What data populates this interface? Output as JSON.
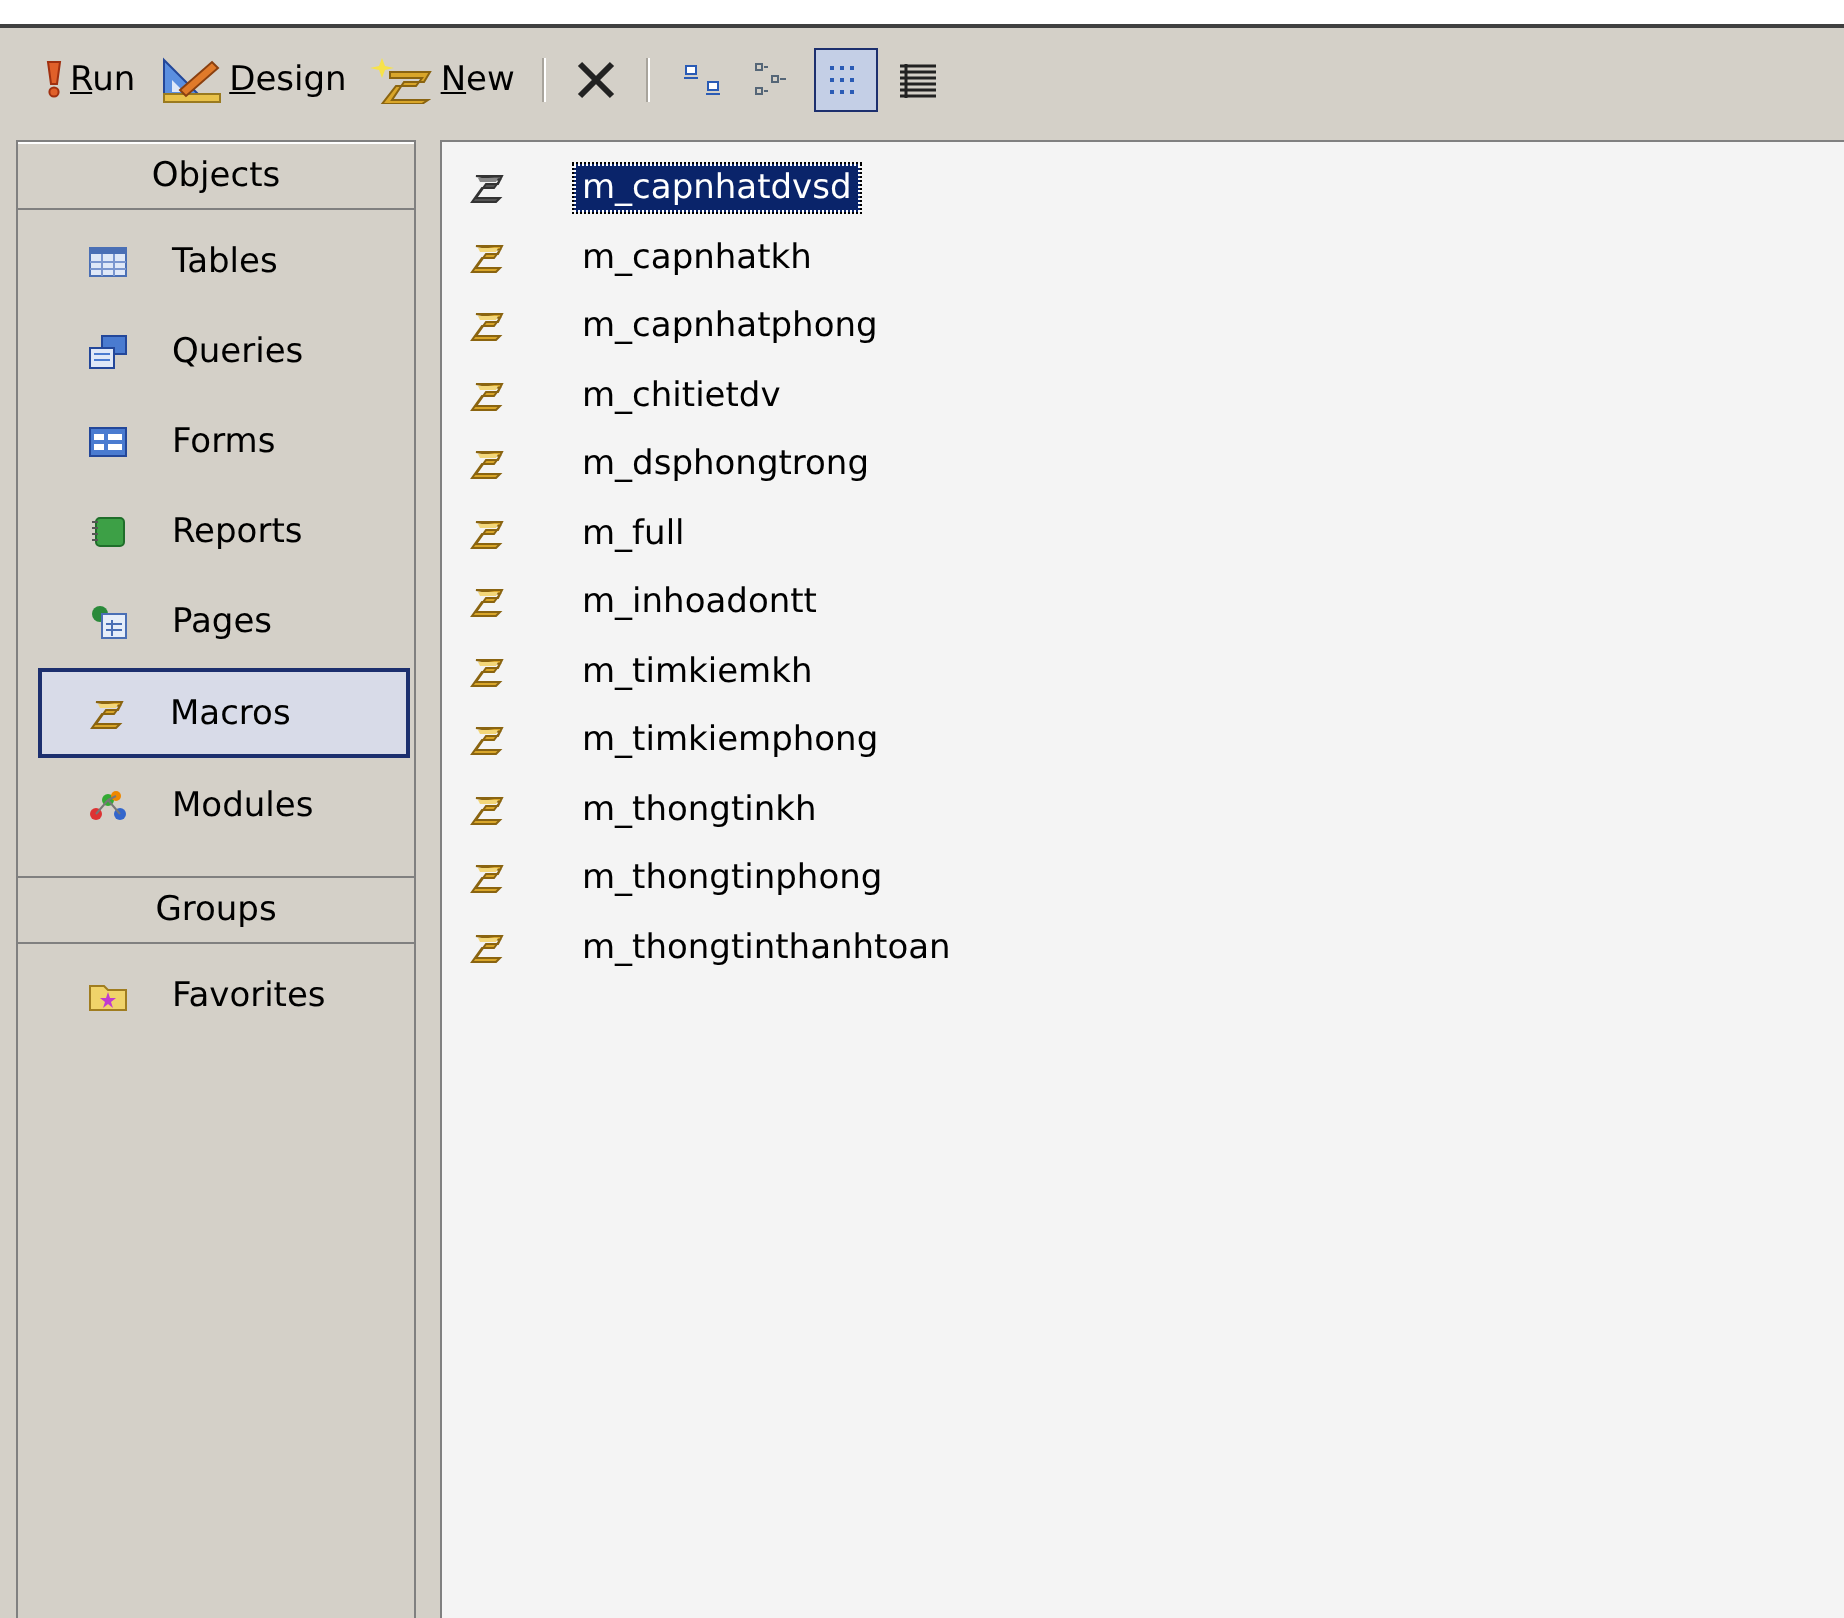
{
  "toolbar": {
    "buttons": [
      {
        "kind": "run",
        "label": "Run"
      },
      {
        "kind": "design",
        "label": "Design"
      },
      {
        "kind": "new",
        "label": "New"
      },
      {
        "kind": "delete"
      }
    ],
    "views": [
      {
        "kind": "large-icons",
        "selected": false
      },
      {
        "kind": "small-icons",
        "selected": false
      },
      {
        "kind": "list",
        "selected": true
      },
      {
        "kind": "details",
        "selected": false
      }
    ]
  },
  "sidebar": {
    "sections": [
      {
        "title": "Objects",
        "items": [
          {
            "kind": "tables",
            "label": "Tables",
            "selected": false
          },
          {
            "kind": "queries",
            "label": "Queries",
            "selected": false
          },
          {
            "kind": "forms",
            "label": "Forms",
            "selected": false
          },
          {
            "kind": "reports",
            "label": "Reports",
            "selected": false
          },
          {
            "kind": "pages",
            "label": "Pages",
            "selected": false
          },
          {
            "kind": "macros",
            "label": "Macros",
            "selected": true
          },
          {
            "kind": "modules",
            "label": "Modules",
            "selected": false
          }
        ]
      },
      {
        "title": "Groups",
        "items": [
          {
            "kind": "favorites",
            "label": "Favorites",
            "selected": false
          }
        ]
      }
    ]
  },
  "list": {
    "items": [
      {
        "label": "m_capnhatdvsd",
        "selected": true
      },
      {
        "label": "m_capnhatkh",
        "selected": false
      },
      {
        "label": "m_capnhatphong",
        "selected": false
      },
      {
        "label": "m_chitietdv",
        "selected": false
      },
      {
        "label": "m_dsphongtrong",
        "selected": false
      },
      {
        "label": "m_full",
        "selected": false
      },
      {
        "label": "m_inhoadontt",
        "selected": false
      },
      {
        "label": "m_timkiemkh",
        "selected": false
      },
      {
        "label": "m_timkiemphong",
        "selected": false
      },
      {
        "label": "m_thongtinkh",
        "selected": false
      },
      {
        "label": "m_thongtinphong",
        "selected": false
      },
      {
        "label": "m_thongtinthanhtoan",
        "selected": false
      }
    ]
  }
}
